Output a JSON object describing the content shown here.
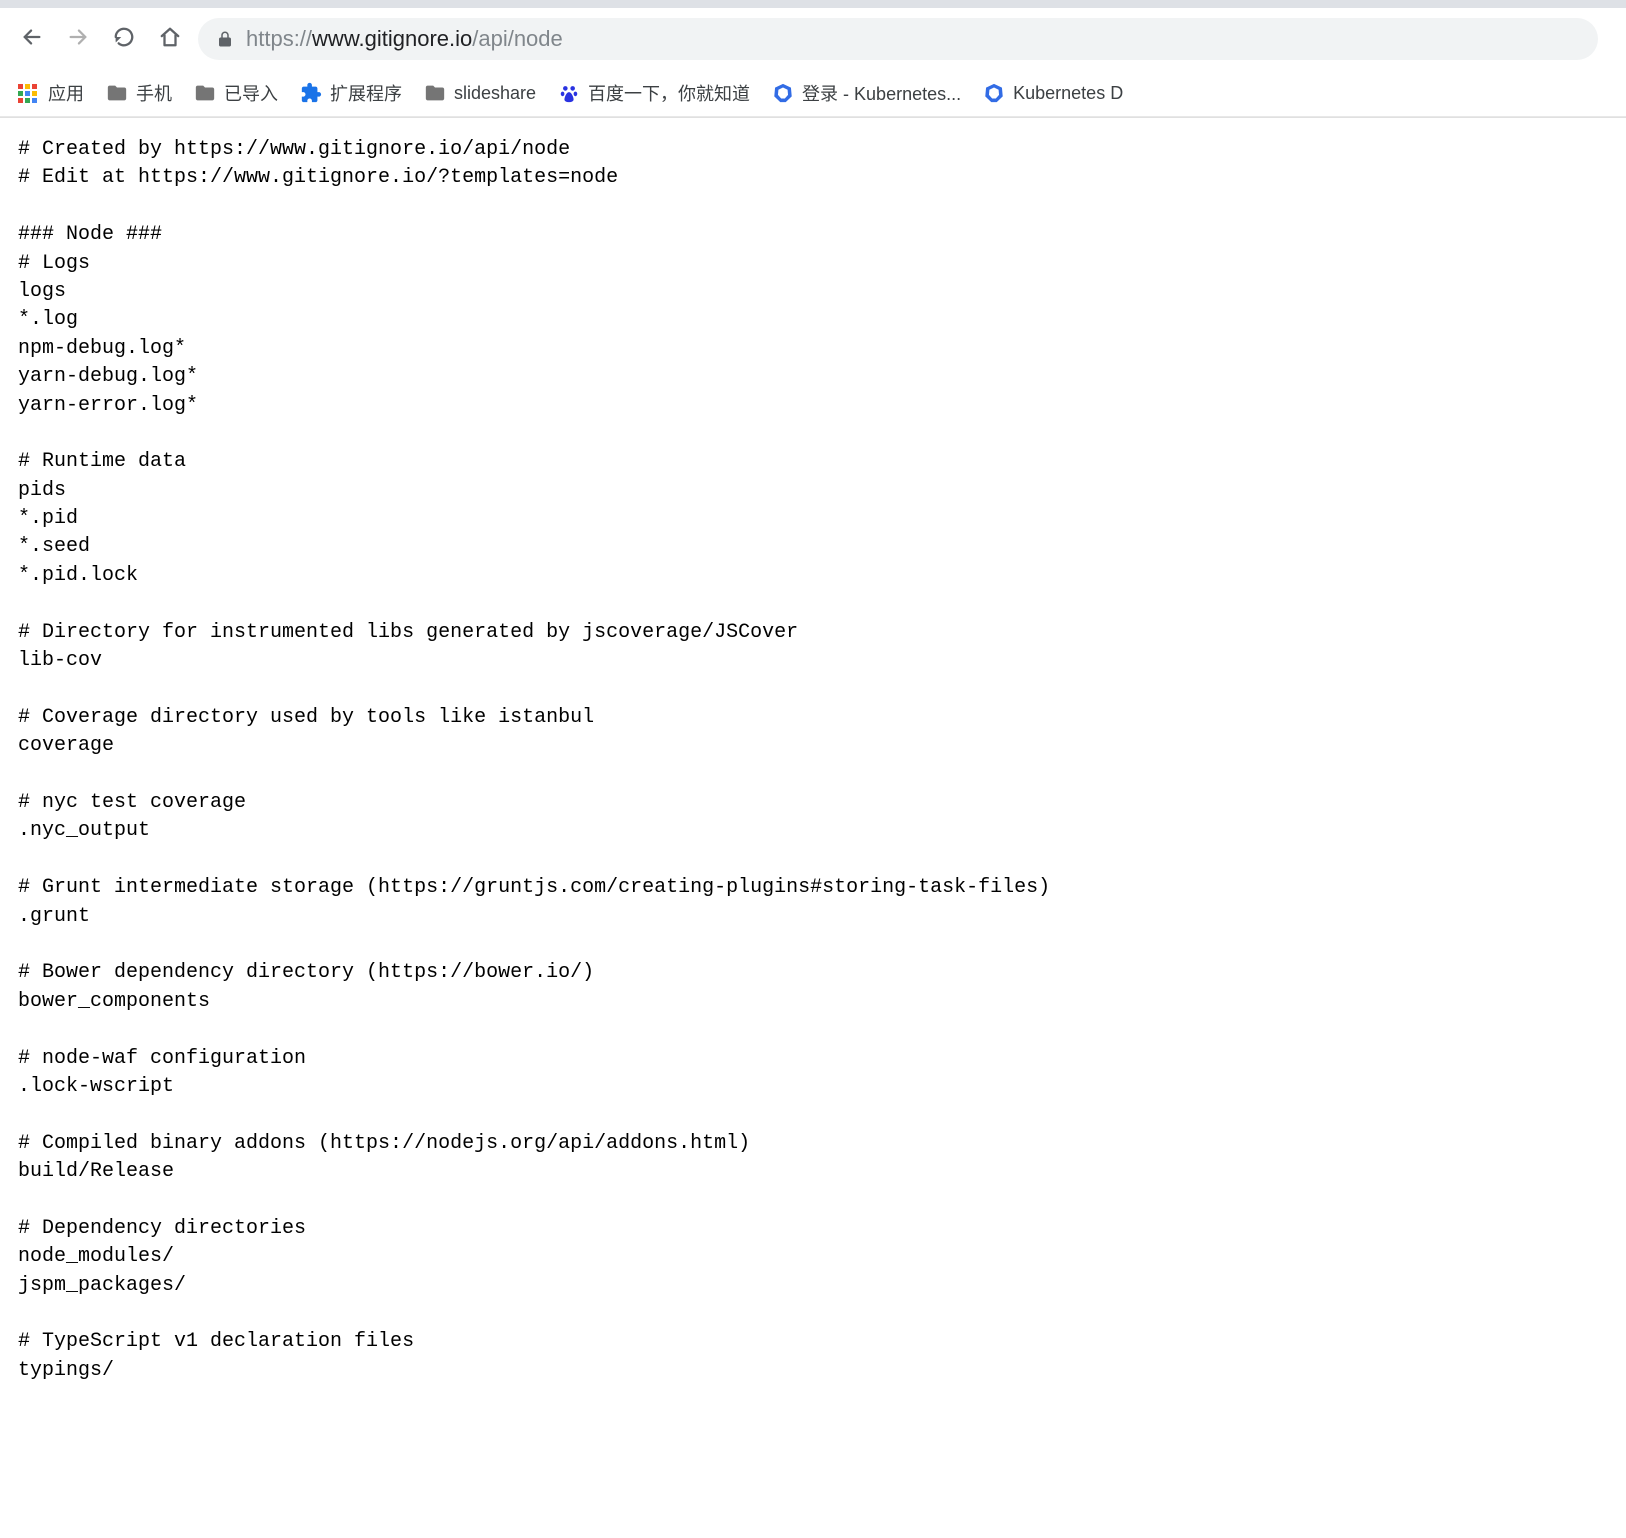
{
  "browser": {
    "url": {
      "protocol": "https://",
      "domain": "www.gitignore.io",
      "path": "/api/node"
    }
  },
  "bookmarks": [
    {
      "id": "apps",
      "label": "应用",
      "icon": "apps"
    },
    {
      "id": "phone",
      "label": "手机",
      "icon": "folder"
    },
    {
      "id": "imported",
      "label": "已导入",
      "icon": "folder"
    },
    {
      "id": "extensions",
      "label": "扩展程序",
      "icon": "puzzle"
    },
    {
      "id": "slideshare",
      "label": "slideshare",
      "icon": "folder"
    },
    {
      "id": "baidu",
      "label": "百度一下，你就知道",
      "icon": "baidu"
    },
    {
      "id": "k8s-login",
      "label": "登录 - Kubernetes...",
      "icon": "k8s"
    },
    {
      "id": "k8s-d",
      "label": "Kubernetes D",
      "icon": "k8s"
    }
  ],
  "content": "# Created by https://www.gitignore.io/api/node\n# Edit at https://www.gitignore.io/?templates=node\n\n### Node ###\n# Logs\nlogs\n*.log\nnpm-debug.log*\nyarn-debug.log*\nyarn-error.log*\n\n# Runtime data\npids\n*.pid\n*.seed\n*.pid.lock\n\n# Directory for instrumented libs generated by jscoverage/JSCover\nlib-cov\n\n# Coverage directory used by tools like istanbul\ncoverage\n\n# nyc test coverage\n.nyc_output\n\n# Grunt intermediate storage (https://gruntjs.com/creating-plugins#storing-task-files)\n.grunt\n\n# Bower dependency directory (https://bower.io/)\nbower_components\n\n# node-waf configuration\n.lock-wscript\n\n# Compiled binary addons (https://nodejs.org/api/addons.html)\nbuild/Release\n\n# Dependency directories\nnode_modules/\njspm_packages/\n\n# TypeScript v1 declaration files\ntypings/"
}
